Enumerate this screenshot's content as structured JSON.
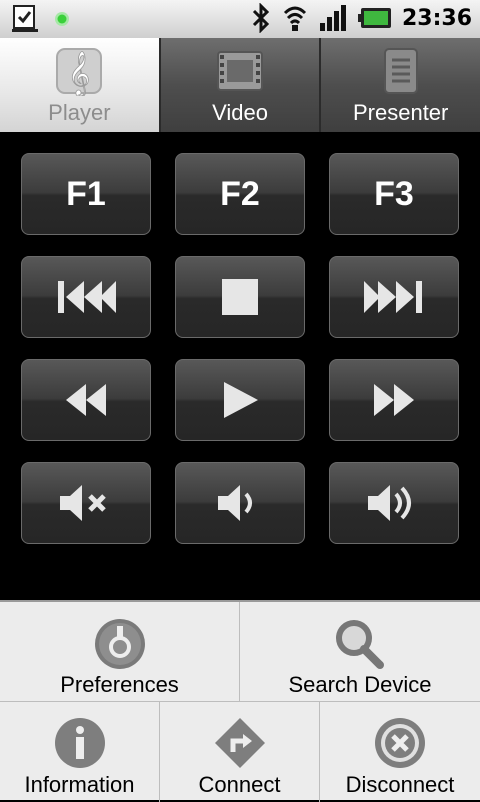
{
  "status_bar": {
    "time": "23:36",
    "icons": [
      "download-complete-icon",
      "led-green-icon",
      "bluetooth-icon",
      "wifi-icon",
      "signal-icon",
      "battery-charging-icon"
    ]
  },
  "tabs": [
    {
      "label": "Player",
      "icon": "treble-clef-icon",
      "active": true
    },
    {
      "label": "Video",
      "icon": "film-icon",
      "active": false
    },
    {
      "label": "Presenter",
      "icon": "document-icon",
      "active": false
    }
  ],
  "remote": {
    "row1": [
      "F1",
      "F2",
      "F3"
    ],
    "row2_icons": [
      "skip-previous-icon",
      "stop-icon",
      "skip-next-icon"
    ],
    "row3_icons": [
      "rewind-icon",
      "play-icon",
      "fast-forward-icon"
    ],
    "row4_icons": [
      "mute-icon",
      "volume-down-icon",
      "volume-up-icon"
    ]
  },
  "menu": {
    "items": [
      {
        "label": "Preferences",
        "icon": "preferences-icon"
      },
      {
        "label": "Search Device",
        "icon": "search-icon"
      },
      {
        "label": "Information",
        "icon": "info-icon"
      },
      {
        "label": "Connect",
        "icon": "connect-icon"
      },
      {
        "label": "Disconnect",
        "icon": "disconnect-icon"
      }
    ]
  },
  "colors": {
    "battery_green": "#3fb83f",
    "led_green": "#3ad03a",
    "button_bg": "#3c3c3c",
    "menu_bg": "#ececec"
  }
}
